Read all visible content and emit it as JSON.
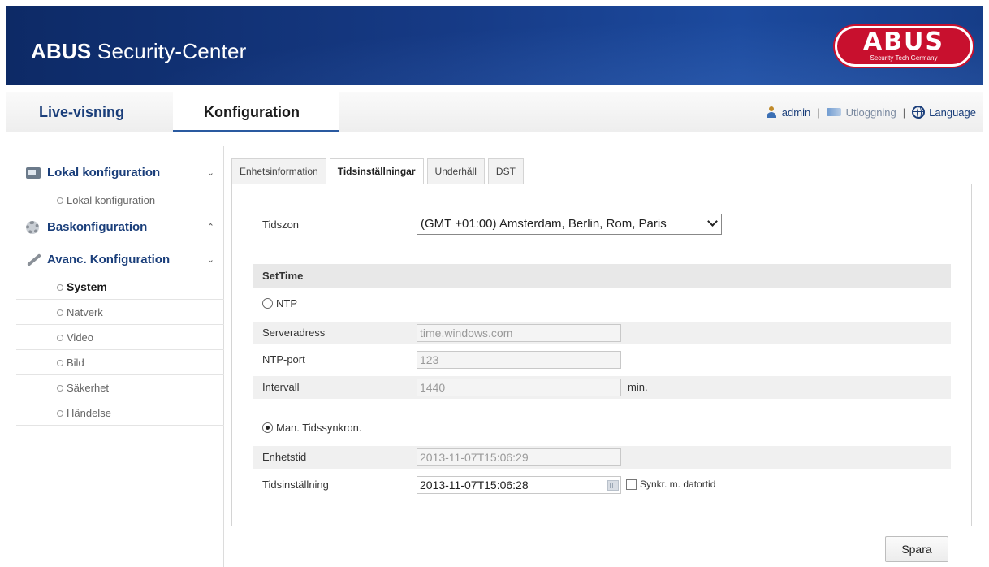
{
  "header": {
    "app_title_bold": "ABUS",
    "app_title_rest": " Security-Center",
    "logo_word": "ABUS",
    "logo_tagline": "Security Tech Germany",
    "brand_color": "#c8102e",
    "banner_color": "#163a85"
  },
  "nav": {
    "tabs": [
      {
        "label": "Live-visning"
      },
      {
        "label": "Konfiguration",
        "active": true
      }
    ],
    "user_label": "admin",
    "separator": "|",
    "logout_label": "Utloggning",
    "language_label": "Language",
    "icons": [
      "user-icon",
      "logout-icon",
      "globe-icon"
    ]
  },
  "sidebar": {
    "sections": [
      {
        "label": "Lokal konfiguration",
        "icon": "monitor-icon",
        "chevron": "⌄",
        "items": [
          {
            "label": "Lokal konfiguration"
          }
        ]
      },
      {
        "label": "Baskonfiguration",
        "icon": "gear-icon",
        "chevron": "⌃",
        "items": []
      },
      {
        "label": "Avanc. Konfiguration",
        "icon": "wrench-icon",
        "chevron": "⌄",
        "items": [
          {
            "label": "System",
            "active": true
          },
          {
            "label": "Nätverk"
          },
          {
            "label": "Video"
          },
          {
            "label": "Bild"
          },
          {
            "label": "Säkerhet"
          },
          {
            "label": "Händelse"
          }
        ]
      }
    ]
  },
  "tabs": [
    {
      "label": "Enhetsinformation"
    },
    {
      "label": "Tidsinställningar",
      "active": true
    },
    {
      "label": "Underhåll"
    },
    {
      "label": "DST"
    }
  ],
  "form": {
    "timezone_label": "Tidszon",
    "timezone_value": "(GMT +01:00) Amsterdam, Berlin, Rom, Paris",
    "section_title": "SetTime",
    "ntp_label": "NTP",
    "ntp_selected": false,
    "server_label": "Serveradress",
    "server_value": "time.windows.com",
    "port_label": "NTP-port",
    "port_value": "123",
    "interval_label": "Intervall",
    "interval_value": "1440",
    "interval_unit": "min.",
    "manual_label": "Man. Tidssynkron.",
    "manual_selected": true,
    "device_time_label": "Enhetstid",
    "device_time_value": "2013-11-07T15:06:29",
    "set_time_label": "Tidsinställning",
    "set_time_value": "2013-11-07T15:06:28",
    "sync_label": "Synkr. m. datortid",
    "sync_checked": false
  },
  "actions": {
    "save_label": "Spara"
  }
}
